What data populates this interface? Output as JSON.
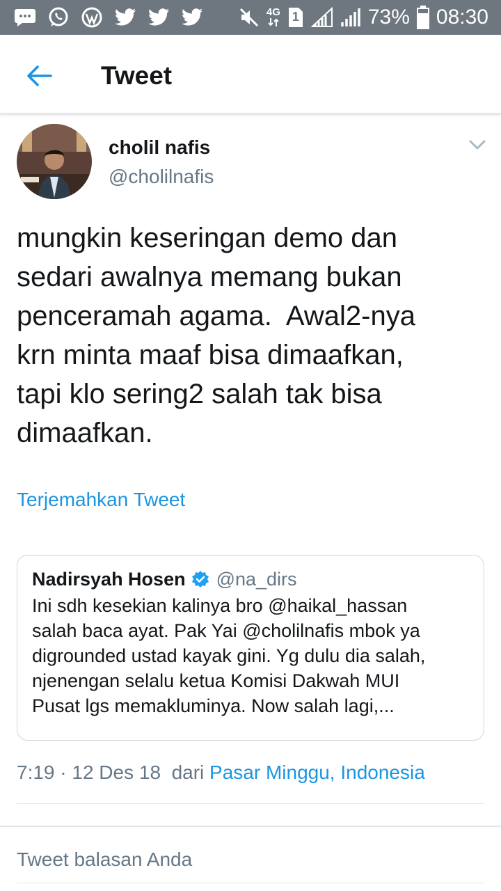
{
  "status_bar": {
    "network": "4G",
    "sim": "1",
    "battery": "73%",
    "time": "08:30",
    "left_icons": [
      "message-icon",
      "whatsapp-icon",
      "wordpress-icon",
      "twitter-icon",
      "twitter-icon",
      "twitter-icon"
    ],
    "right_icons": [
      "mute-icon",
      "network-4g-icon",
      "sim-icon",
      "signal-icon",
      "signal-icon",
      "battery-icon"
    ]
  },
  "appbar": {
    "title": "Tweet",
    "back_icon": "back-arrow-icon"
  },
  "tweet": {
    "display_name": "cholil nafis",
    "handle": "@cholilnafis",
    "text_lines": [
      "mungkin keseringan demo dan",
      "sedari awalnya memang bukan",
      "penceramah agama.  Awal2-nya",
      "krn minta maaf bisa dimaafkan,",
      "tapi klo sering2 salah tak bisa",
      "dimaafkan."
    ],
    "translate_link": "Terjemahkan Tweet",
    "meta_prefix": "7:19 · 12 Des 18  dari ",
    "location": "Pasar Minggu, Indonesia"
  },
  "quoted_tweet": {
    "display_name": "Nadirsyah Hosen",
    "handle": "@na_dirs",
    "text_lines": [
      "Ini sdh kesekian kalinya bro @haikal_hassan",
      "salah baca ayat. Pak Yai @cholilnafis mbok ya",
      "digrounded ustad kayak gini. Yg dulu dia salah,",
      "njenengan selalu ketua Komisi Dakwah MUI",
      "Pusat lgs memakluminya. Now salah lagi,..."
    ]
  },
  "reply": {
    "placeholder": "Tweet balasan Anda"
  },
  "colors": {
    "status_bar": "#6e7780",
    "accent": "#1b95e0",
    "text_primary": "#14171a",
    "text_secondary": "#657786",
    "divider": "#e1e8ed"
  }
}
